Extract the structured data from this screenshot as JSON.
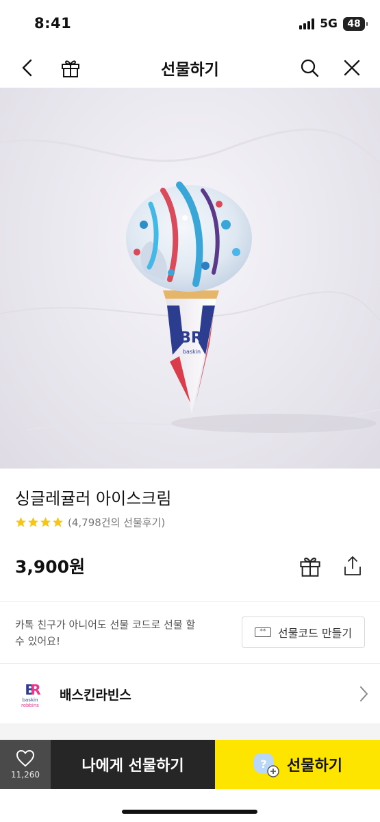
{
  "status_bar": {
    "time": "8:41",
    "network": "5G",
    "battery": "48"
  },
  "nav": {
    "title": "선물하기",
    "icons": [
      "back-icon",
      "gift-icon",
      "search-icon",
      "close-icon"
    ]
  },
  "product": {
    "name": "싱글레귤러 아이스크림",
    "rating_stars": 4,
    "review_text": "(4,798건의 선물후기)",
    "price": "3,900원"
  },
  "gift_code": {
    "description": "카톡 친구가 아니어도 선물 코드로 선물 할 수 있어요!",
    "button_label": "선물코드 만들기",
    "button_icon_text": "**"
  },
  "brand": {
    "name": "배스킨라빈스"
  },
  "bottom_bar": {
    "like_count": "11,260",
    "gift_me_label": "나에게 선물하기",
    "gift_label": "선물하기",
    "gift_badge_text": "?"
  },
  "colors": {
    "kakao_yellow": "#FEE500",
    "dark": "#262626",
    "like_bg": "#4A4A4A",
    "star": "#F5C518"
  }
}
